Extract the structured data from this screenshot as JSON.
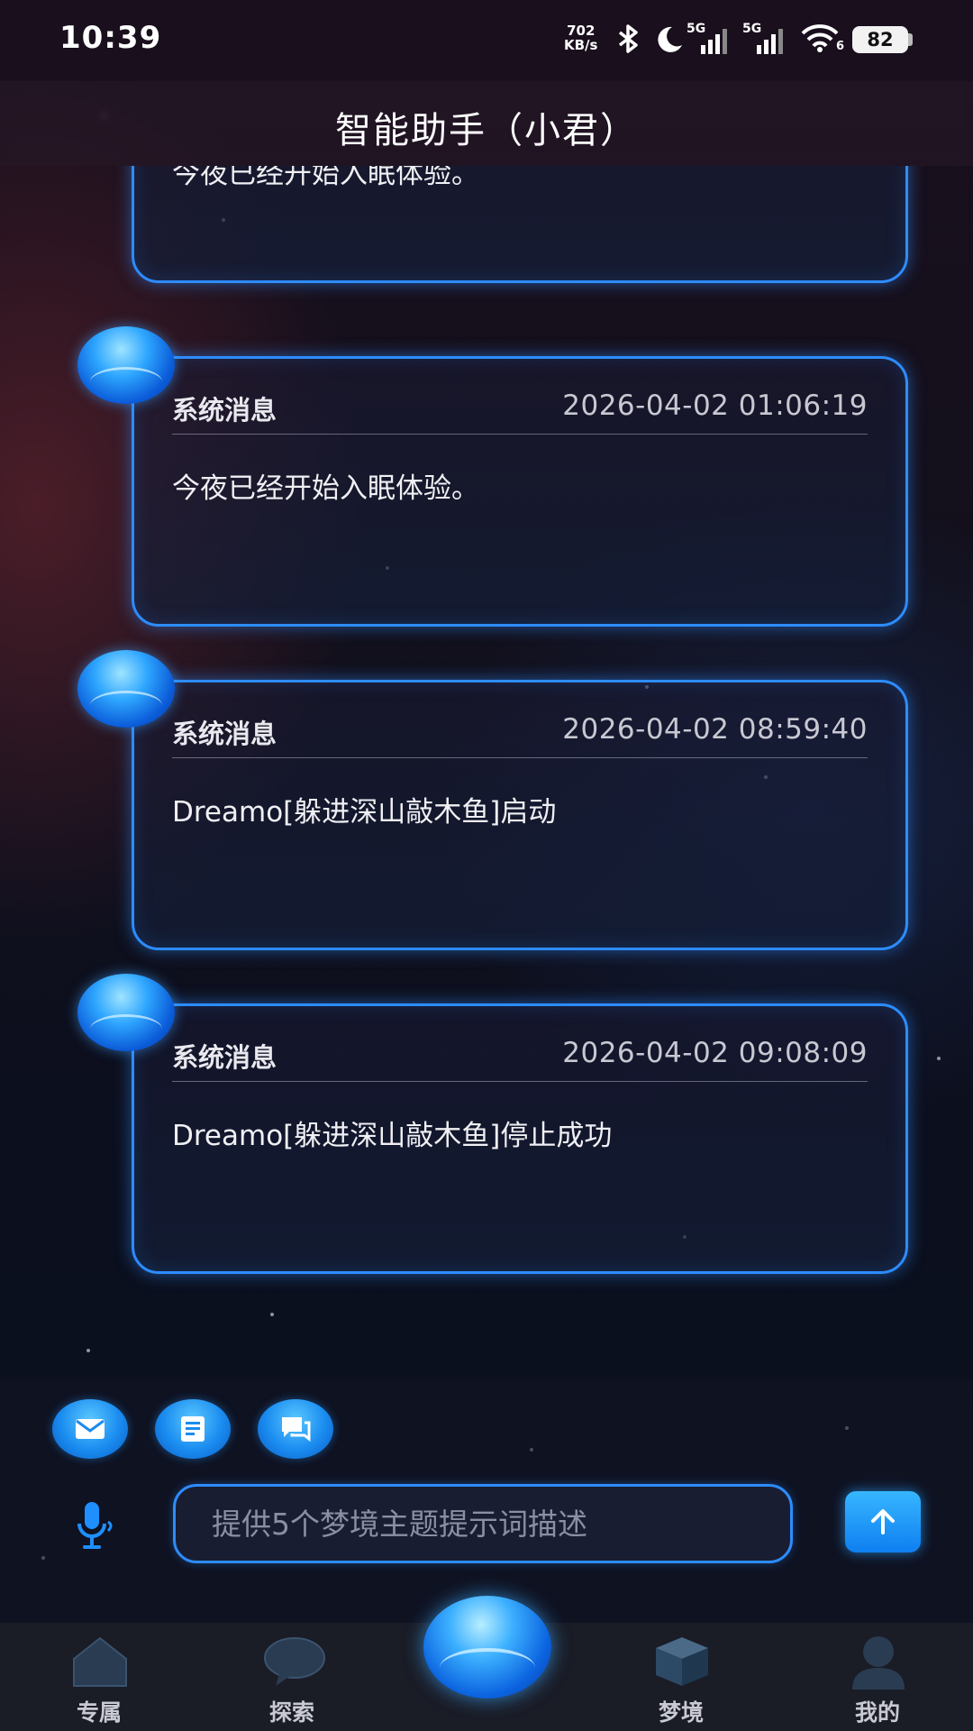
{
  "status_bar": {
    "time": "10:39",
    "net_speed_value": "702",
    "net_speed_unit": "KB/s",
    "signal_1": "5G",
    "signal_2": "5G",
    "wifi_label": "6",
    "battery": "82"
  },
  "header": {
    "title": "智能助手（小君）"
  },
  "messages": [
    {
      "sender": "",
      "time": "",
      "body": "今夜已经开始入眠体验。"
    },
    {
      "sender": "系统消息",
      "time": "2026-04-02 01:06:19",
      "body": "今夜已经开始入眠体验。"
    },
    {
      "sender": "系统消息",
      "time": "2026-04-02 08:59:40",
      "body": "Dreamo[躲进深山敲木鱼]启动"
    },
    {
      "sender": "系统消息",
      "time": "2026-04-02 09:08:09",
      "body": "Dreamo[躲进深山敲木鱼]停止成功"
    }
  ],
  "quick_actions": [
    {
      "icon": "mail-icon"
    },
    {
      "icon": "document-icon"
    },
    {
      "icon": "chat-icon"
    }
  ],
  "input": {
    "placeholder": "提供5个梦境主题提示词描述",
    "value": ""
  },
  "bottom_nav": [
    {
      "label": "专属",
      "icon": "house-icon"
    },
    {
      "label": "探索",
      "icon": "speech-bubble-icon"
    },
    {
      "label": "",
      "icon": "orb-icon"
    },
    {
      "label": "梦境",
      "icon": "cube-icon"
    },
    {
      "label": "我的",
      "icon": "person-icon"
    }
  ],
  "colors": {
    "accent": "#2d8cff",
    "orb": "#1a8cf0"
  }
}
